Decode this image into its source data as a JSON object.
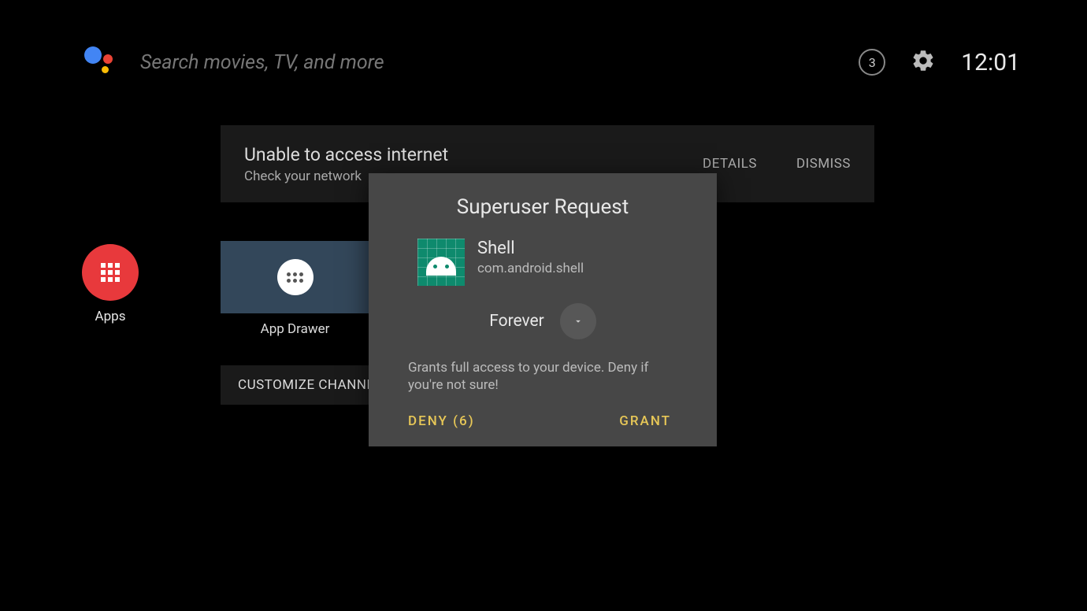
{
  "header": {
    "search_placeholder": "Search movies, TV, and more",
    "badge": "3",
    "clock": "12:01"
  },
  "notification": {
    "title": "Unable to access internet",
    "subtitle": "Check your network",
    "details": "DETAILS",
    "dismiss": "DISMISS"
  },
  "apps": {
    "label": "Apps",
    "drawer": "App Drawer"
  },
  "customize": {
    "label": "CUSTOMIZE CHANNE"
  },
  "dialog": {
    "title": "Superuser Request",
    "app_name": "Shell",
    "package": "com.android.shell",
    "duration": "Forever",
    "warning": "Grants full access to your device. Deny if you're not sure!",
    "deny": "DENY (6)",
    "grant": "GRANT"
  }
}
